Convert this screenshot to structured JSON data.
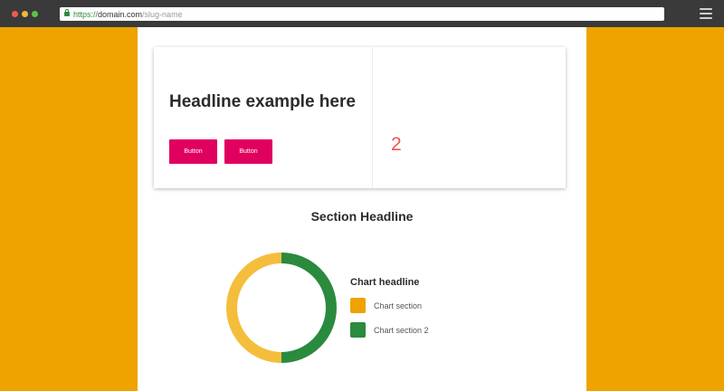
{
  "browser": {
    "url_scheme": "https://",
    "url_domain": "domain.com",
    "url_path": "/slug-name"
  },
  "hero": {
    "headline": "Headline example here",
    "button_1_label": "Button",
    "button_2_label": "Button",
    "number": "2"
  },
  "section": {
    "headline": "Section Headline"
  },
  "chart_data": {
    "type": "pie",
    "title": "Chart headline",
    "categories": [
      "Chart section",
      "Chart section 2"
    ],
    "values": [
      50,
      50
    ],
    "colors": [
      "#EEA300",
      "#2A8A3E"
    ]
  },
  "colors": {
    "page_background": "#EEA300",
    "button": "#E0005E",
    "donut_left_arc": "#F4BE3C",
    "donut_right_arc": "#2A8A3E"
  }
}
